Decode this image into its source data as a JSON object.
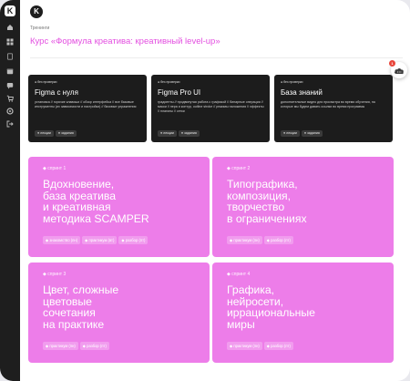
{
  "header": {
    "logo_text": "K",
    "breadcrumb": "Тренинги",
    "page_title": "Курс «Формула креатива: креативный level-up»"
  },
  "sidebar": {
    "logo_text": "K",
    "icons": [
      "home-icon",
      "grid-icon",
      "book-icon",
      "calendar-icon",
      "chat-icon",
      "cart-icon",
      "settings-icon",
      "logout-icon"
    ]
  },
  "notification": {
    "count": "1"
  },
  "intro_cards": [
    {
      "badge": "● без проверки",
      "title": "Figma с нуля",
      "desc": "установка // горячие клавиши // обзор интерфейса // все базовые инструменты (их зависимости и настройки) // базовые упражнения",
      "tags": [
        "● лекции",
        "● задания"
      ]
    },
    {
      "badge": "● без проверки",
      "title": "Figma Pro UI",
      "desc": "градиенты // продвинутая работа с графикой // бинарные операции // маски // пера и контур, outline stroke // режимы наложения // эффекты // плагины // сетки",
      "tags": [
        "● лекции",
        "● задания"
      ]
    },
    {
      "badge": "● без проверки",
      "title": "База знаний",
      "desc": "дополнительные видео для просмотра во время обучения, на которые мы будем давать ссылки во время программы",
      "tags": [
        "● лекции",
        "● задания"
      ]
    }
  ],
  "sprints": [
    {
      "label": "◆ спринт 1",
      "title_lines": [
        "Вдохновение,",
        "база креатива",
        "и креативная",
        "методика SCAMPER"
      ],
      "tags": [
        "◆ знакомство (пн)",
        "◆ практикум (вт)",
        "◆ разбор (пт)"
      ]
    },
    {
      "label": "◆ спринт 2",
      "title_lines": [
        "Типографика,",
        "композиция,",
        "творчество",
        "в ограничениях"
      ],
      "tags": [
        "◆ практикум (пн)",
        "◆ разбор (пт)"
      ]
    },
    {
      "label": "◆ спринт 3",
      "title_lines": [
        "Цвет, сложные",
        "цветовые",
        "сочетания",
        "на практике"
      ],
      "tags": [
        "◆ практикум (пн)",
        "◆ разбор (пт)"
      ]
    },
    {
      "label": "◆ спринт 4",
      "title_lines": [
        "Графика,",
        "нейросети,",
        "иррациональные",
        "миры"
      ],
      "tags": [
        "◆ практикум (пн)",
        "◆ разбор (пт)"
      ]
    }
  ]
}
